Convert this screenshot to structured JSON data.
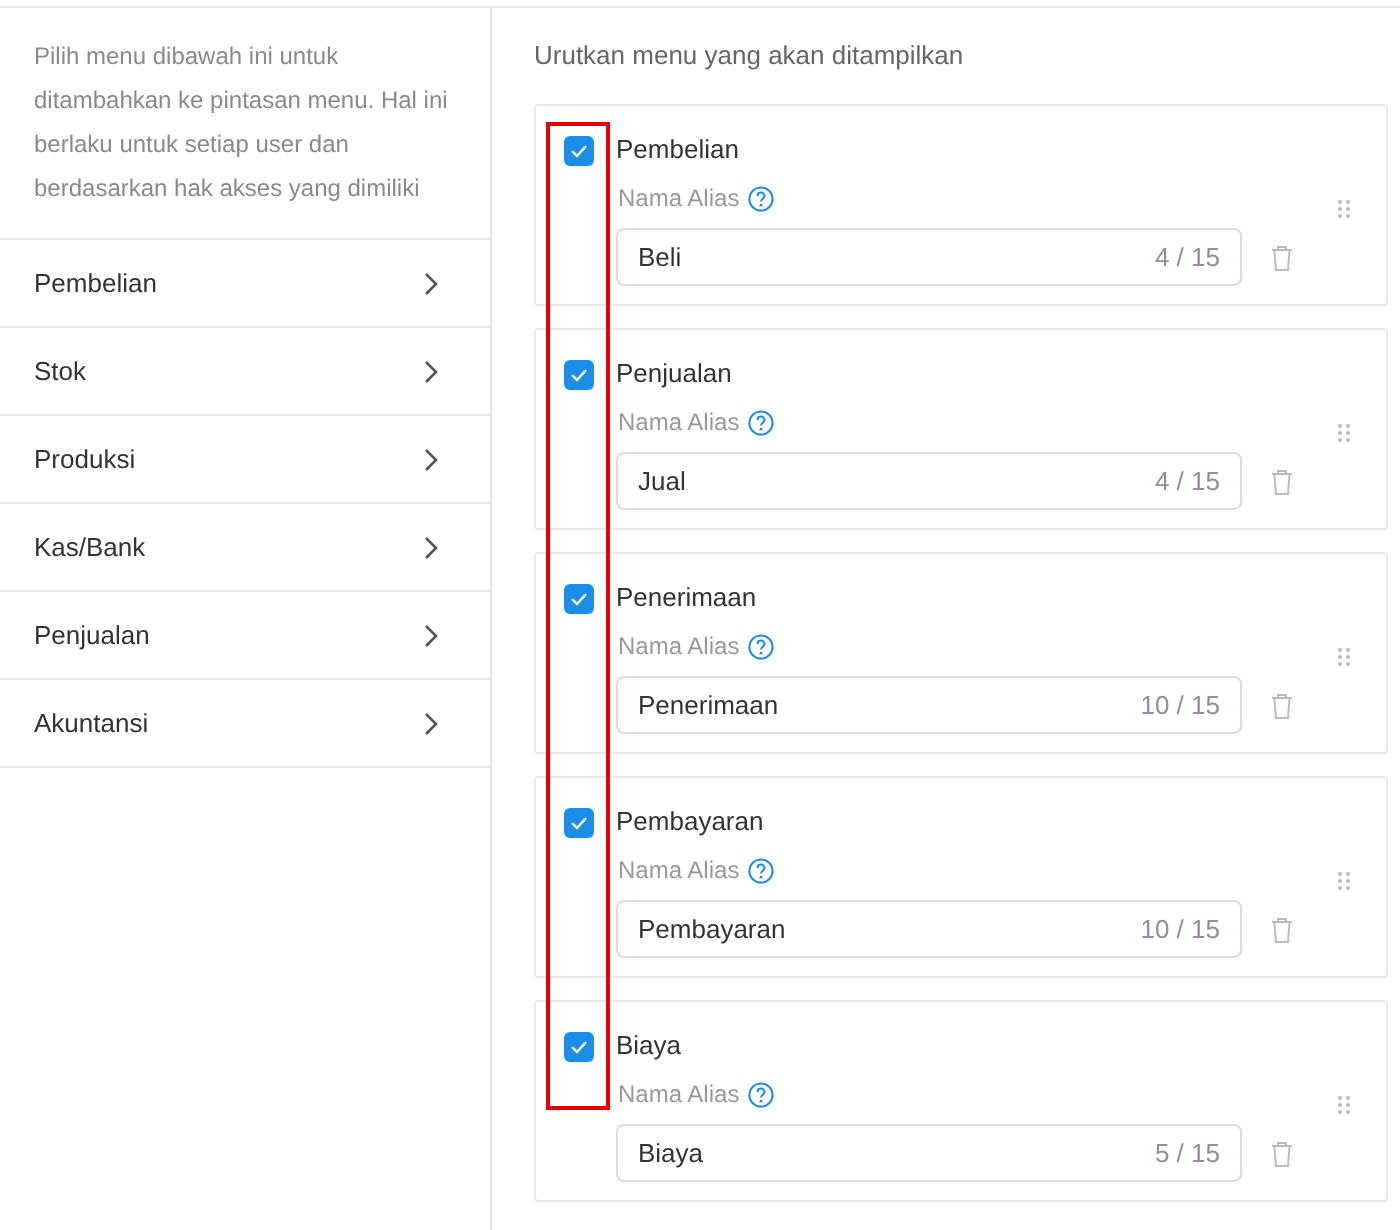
{
  "sidebar": {
    "description": "Pilih menu dibawah ini untuk ditambahkan ke pintasan menu. Hal ini berlaku untuk setiap user dan berdasarkan hak akses yang dimiliki",
    "items": [
      {
        "label": "Pembelian"
      },
      {
        "label": "Stok"
      },
      {
        "label": "Produksi"
      },
      {
        "label": "Kas/Bank"
      },
      {
        "label": "Penjualan"
      },
      {
        "label": "Akuntansi"
      }
    ]
  },
  "main": {
    "title": "Urutkan menu yang akan ditampilkan",
    "menus": [
      {
        "name": "Pembelian",
        "checked": true,
        "alias_label": "Nama Alias",
        "value": "Beli",
        "counter": "4 / 15"
      },
      {
        "name": "Penjualan",
        "checked": true,
        "alias_label": "Nama Alias",
        "value": "Jual",
        "counter": "4 / 15"
      },
      {
        "name": "Penerimaan",
        "checked": true,
        "alias_label": "Nama Alias",
        "value": "Penerimaan",
        "counter": "10 / 15"
      },
      {
        "name": "Pembayaran",
        "checked": true,
        "alias_label": "Nama Alias",
        "value": "Pembayaran",
        "counter": "10 / 15"
      },
      {
        "name": "Biaya",
        "checked": true,
        "alias_label": "Nama Alias",
        "value": "Biaya",
        "counter": "5 / 15"
      }
    ]
  }
}
